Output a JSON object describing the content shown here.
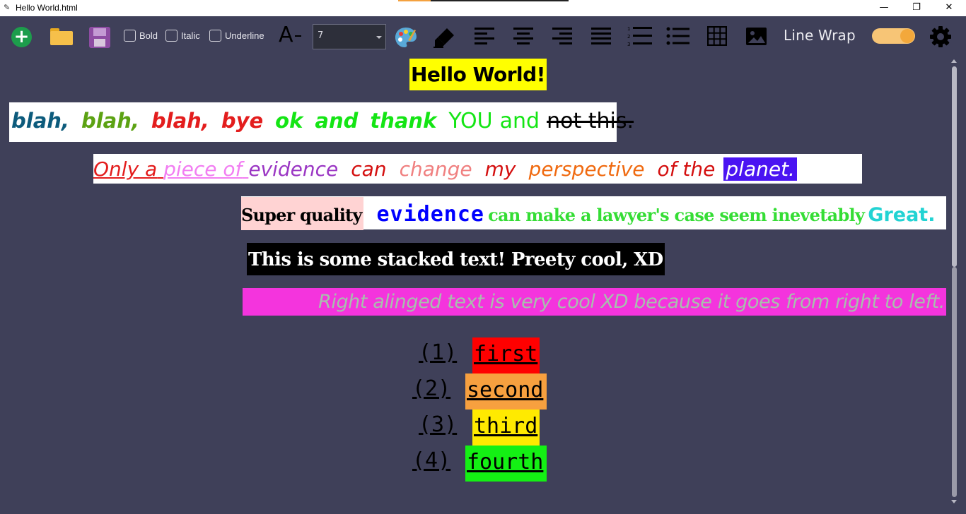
{
  "window": {
    "title": "Hello World.html",
    "app_icon": "pencil-icon",
    "minimize_glyph": "—",
    "maximize_glyph": "❐",
    "close_glyph": "✕"
  },
  "toolbar": {
    "new_icon": "add-icon",
    "open_icon": "folder-icon",
    "save_icon": "floppy-disk-icon",
    "bold_label": "Bold",
    "italic_label": "Italic",
    "underline_label": "Underline",
    "font_size_icon": "font-size-decrease-icon",
    "font_size_value": "7",
    "color_icon": "palette-icon",
    "highlight_icon": "highlighter-icon",
    "align_icons": [
      "align-left-icon",
      "align-center-icon",
      "align-right-icon",
      "align-justify-icon"
    ],
    "ordered_list_icon": "ordered-list-icon",
    "unordered_list_icon": "bullet-list-icon",
    "table_icon": "table-icon",
    "image_icon": "image-icon",
    "line_wrap_label": "Line Wrap",
    "line_wrap_on": true,
    "settings_icon": "gear-icon",
    "accent_color": "#f3a83b"
  },
  "document": {
    "heading": "Hello World!",
    "line2": [
      {
        "text": "blah,",
        "color": "#0d5b7c"
      },
      {
        "text": "blah,",
        "color": "#5ca213"
      },
      {
        "text": "blah,",
        "color": "#e31d1d"
      },
      {
        "text": "bye",
        "color": "#e31d1d"
      },
      {
        "text": "ok",
        "color": "#14e514"
      },
      {
        "text": "and",
        "color": "#14e514"
      },
      {
        "text": "thank",
        "color": "#14e514"
      },
      {
        "text": "YOU",
        "color": "#14e514"
      },
      {
        "text": "and",
        "color": "#14e514"
      },
      {
        "text": "not this.",
        "color": "#000000"
      }
    ],
    "line3": [
      {
        "text": "Only a",
        "color": "#e31d1d"
      },
      {
        "text": "piece of",
        "color": "#f27ef2"
      },
      {
        "text": "evidence",
        "color": "#9b37c4"
      },
      {
        "text": "can",
        "color": "#d40f0f"
      },
      {
        "text": "change",
        "color": "#f08080"
      },
      {
        "text": "my",
        "color": "#d40f0f"
      },
      {
        "text": "perspective",
        "color": "#f06a10"
      },
      {
        "text": "of the",
        "color": "#d40f0f"
      },
      {
        "text": "planet.",
        "color": "#ffffff"
      }
    ],
    "line4": {
      "super_quality": "Super quality",
      "evidence": "evidence",
      "rest": "can make a lawyer's case seem inevetably",
      "great": "Great."
    },
    "stacked": "This is some stacked text! Preety cool, XD",
    "right_aligned": "Right alinged text is very cool XD because it goes from  right to left.",
    "ordered_list": [
      {
        "num": "(1)",
        "label": "first",
        "bg": "#ff0000"
      },
      {
        "num": "(2)",
        "label": "second",
        "bg": "#f7a03f"
      },
      {
        "num": "(3)",
        "label": "third",
        "bg": "#ffea00"
      },
      {
        "num": "(4)",
        "label": "fourth",
        "bg": "#14f014"
      }
    ]
  }
}
